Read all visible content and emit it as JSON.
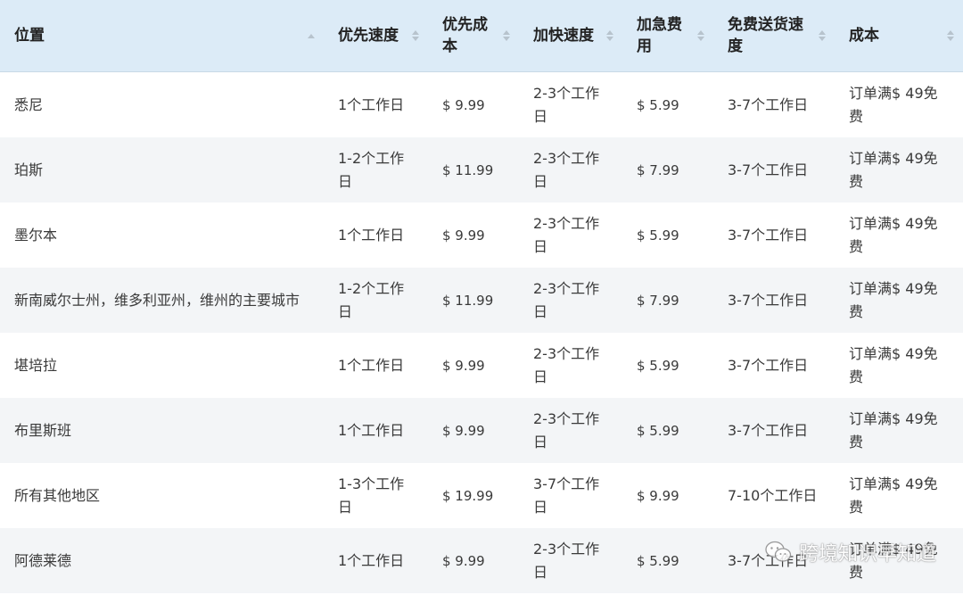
{
  "table": {
    "headers": [
      {
        "label": "位置",
        "sort": "up"
      },
      {
        "label": "优先速度",
        "sort": "both"
      },
      {
        "label": "优先成本",
        "sort": "both"
      },
      {
        "label": "加快速度",
        "sort": "both"
      },
      {
        "label": "加急费用",
        "sort": "both"
      },
      {
        "label": "免费送货速度",
        "sort": "both"
      },
      {
        "label": "成本",
        "sort": "both"
      }
    ],
    "rows": [
      [
        "悉尼",
        "1个工作日",
        "$ 9.99",
        "2-3个工作日",
        "$ 5.99",
        "3-7个工作日",
        "订单满$ 49免费"
      ],
      [
        "珀斯",
        "1-2个工作日",
        "$ 11.99",
        "2-3个工作日",
        "$ 7.99",
        "3-7个工作日",
        "订单满$ 49免费"
      ],
      [
        "墨尔本",
        "1个工作日",
        "$ 9.99",
        "2-3个工作日",
        "$ 5.99",
        "3-7个工作日",
        "订单满$ 49免费"
      ],
      [
        "新南威尔士州，维多利亚州，维州的主要城市",
        "1-2个工作日",
        "$ 11.99",
        "2-3个工作日",
        "$ 7.99",
        "3-7个工作日",
        "订单满$ 49免费"
      ],
      [
        "堪培拉",
        "1个工作日",
        "$ 9.99",
        "2-3个工作日",
        "$ 5.99",
        "3-7个工作日",
        "订单满$ 49免费"
      ],
      [
        "布里斯班",
        "1个工作日",
        "$ 9.99",
        "2-3个工作日",
        "$ 5.99",
        "3-7个工作日",
        "订单满$ 49免费"
      ],
      [
        "所有其他地区",
        "1-3个工作日",
        "$ 19.99",
        "3-7个工作日",
        "$ 9.99",
        "7-10个工作日",
        "订单满$ 49免费"
      ],
      [
        "阿德莱德",
        "1个工作日",
        "$ 9.99",
        "2-3个工作日",
        "$ 5.99",
        "3-7个工作日",
        "订单满$ 49免费"
      ]
    ]
  },
  "watermark": {
    "text": "跨境知识早知道",
    "icon": "wechat-icon"
  }
}
